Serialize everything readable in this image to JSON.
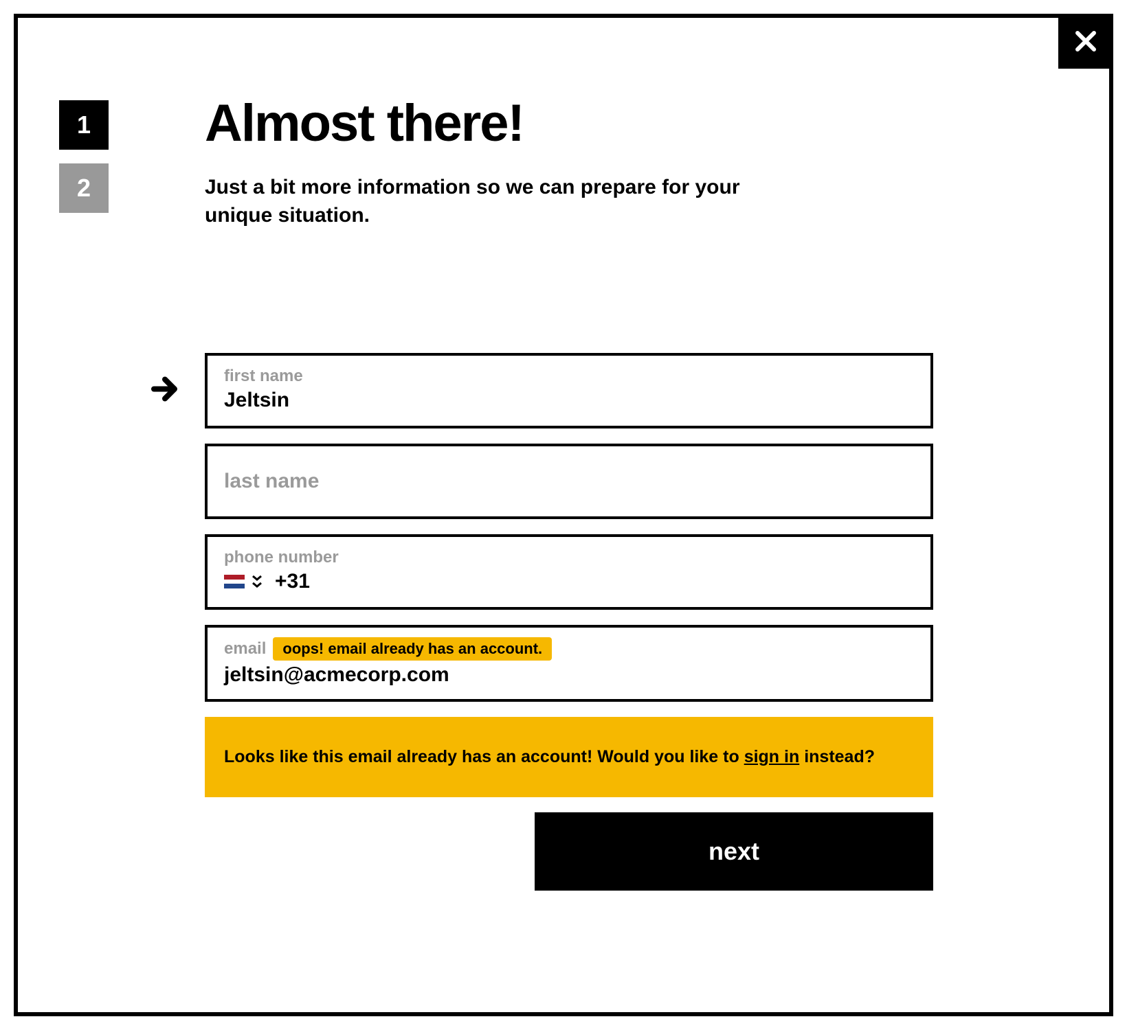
{
  "steps": [
    {
      "number": "1",
      "active": true
    },
    {
      "number": "2",
      "active": false
    }
  ],
  "header": {
    "title": "Almost there!",
    "subtitle": "Just a bit more information so we can prepare for your unique situation."
  },
  "form": {
    "first_name": {
      "label": "first name",
      "value": "Jeltsin"
    },
    "last_name": {
      "placeholder": "last name",
      "value": ""
    },
    "phone": {
      "label": "phone number",
      "prefix": "+31",
      "value": "",
      "country_flag": {
        "colors": [
          "#AE1C28",
          "#FFFFFF",
          "#21468B"
        ]
      }
    },
    "email": {
      "label": "email",
      "value": "jeltsin@acmecorp.com",
      "inline_error": "oops! email already has an account."
    }
  },
  "alert": {
    "text_before": "Looks like this email already has an account! Would you like to ",
    "link_text": "sign in",
    "text_after": " instead?"
  },
  "actions": {
    "next": "next"
  }
}
